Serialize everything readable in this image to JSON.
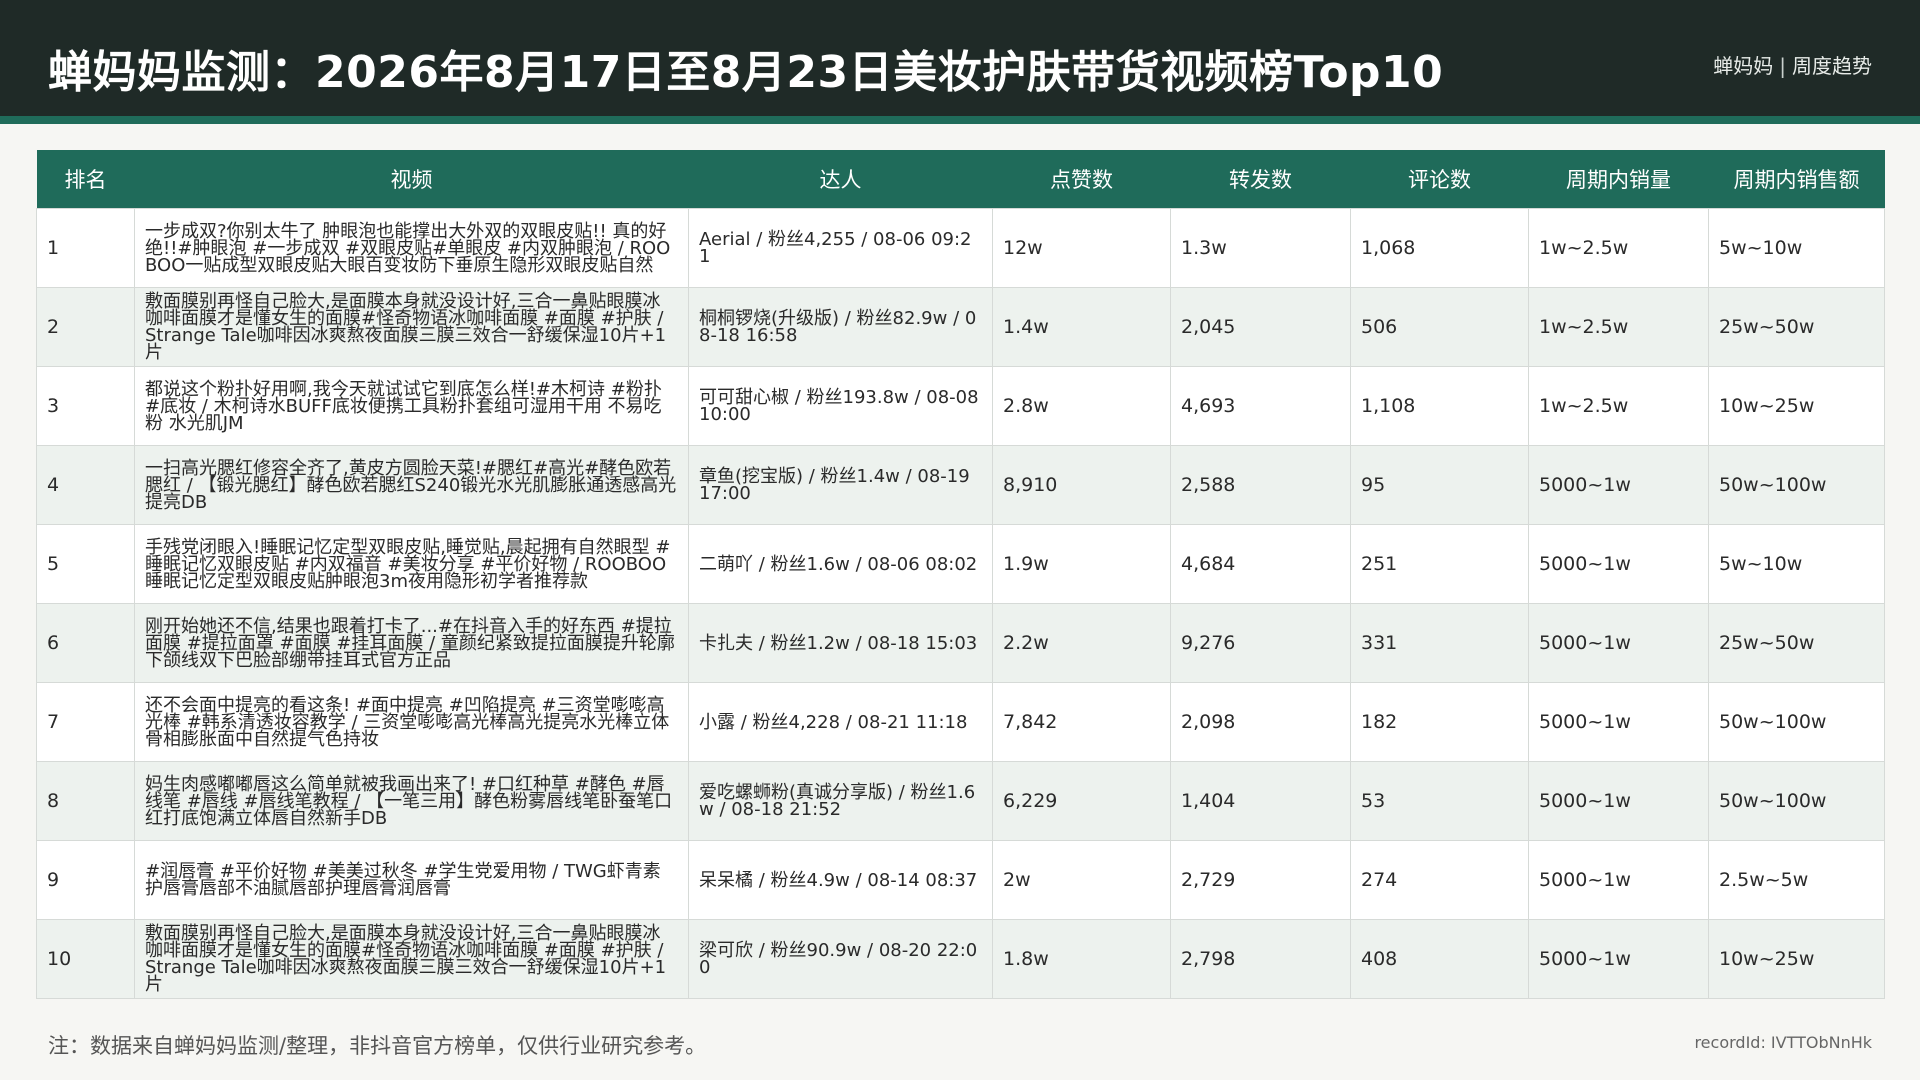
{
  "header": {
    "title": "蝉妈妈监测：2026年8月17日至8月23日美妆护肤带货视频榜Top10",
    "brand": "蝉妈妈",
    "brand_sep": "|",
    "brand_sub": "周度趋势"
  },
  "table": {
    "columns": [
      "排名",
      "视频",
      "达人",
      "点赞数",
      "转发数",
      "评论数",
      "周期内销量",
      "周期内销售额"
    ],
    "rows": [
      {
        "rank": "1",
        "video": "一步成双?你别太牛了 肿眼泡也能撑出大外双的双眼皮贴!! 真的好绝!!#肿眼泡 #一步成双 #双眼皮贴#单眼皮 #内双肿眼泡 / ROOBOO一贴成型双眼皮贴大眼百变妆防下垂原生隐形双眼皮贴自然",
        "talent": "Aerial / 粉丝4,255 / 08-06 09:21",
        "likes": "12w",
        "shares": "1.3w",
        "comments": "1,068",
        "sales": "1w~2.5w",
        "revenue": "5w~10w"
      },
      {
        "rank": "2",
        "video": "敷面膜别再怪自己脸大,是面膜本身就没设计好,三合一鼻贴眼膜冰咖啡面膜才是懂女生的面膜#怪奇物语冰咖啡面膜 #面膜 #护肤 / Strange Tale咖啡因冰爽熬夜面膜三膜三效合一舒缓保湿10片+1片",
        "talent": "桐桐锣烧(升级版) / 粉丝82.9w / 08-18 16:58",
        "likes": "1.4w",
        "shares": "2,045",
        "comments": "506",
        "sales": "1w~2.5w",
        "revenue": "25w~50w"
      },
      {
        "rank": "3",
        "video": "都说这个粉扑好用啊,我今天就试试它到底怎么样!#木柯诗 #粉扑 #底妆 / 木柯诗水BUFF底妆便携工具粉扑套组可湿用干用 不易吃粉 水光肌JM",
        "talent": "可可甜心椒 / 粉丝193.8w / 08-08 10:00",
        "likes": "2.8w",
        "shares": "4,693",
        "comments": "1,108",
        "sales": "1w~2.5w",
        "revenue": "10w~25w"
      },
      {
        "rank": "4",
        "video": "一扫高光腮红修容全齐了,黄皮方圆脸天菜!#腮红#高光#酵色欧若腮红 / 【锻光腮红】酵色欧若腮红S240锻光水光肌膨胀通透感高光提亮DB",
        "talent": "章鱼(挖宝版) / 粉丝1.4w / 08-19 17:00",
        "likes": "8,910",
        "shares": "2,588",
        "comments": "95",
        "sales": "5000~1w",
        "revenue": "50w~100w"
      },
      {
        "rank": "5",
        "video": "手残党闭眼入!睡眠记忆定型双眼皮贴,睡觉贴,晨起拥有自然眼型 #睡眠记忆双眼皮贴 #内双福音 #美妆分享 #平价好物 / ROOBOO睡眠记忆定型双眼皮贴肿眼泡3m夜用隐形初学者推荐款",
        "talent": "二萌吖 / 粉丝1.6w / 08-06 08:02",
        "likes": "1.9w",
        "shares": "4,684",
        "comments": "251",
        "sales": "5000~1w",
        "revenue": "5w~10w"
      },
      {
        "rank": "6",
        "video": "刚开始她还不信,结果也跟着打卡了...#在抖音入手的好东西 #提拉面膜 #提拉面罩 #面膜 #挂耳面膜 / 童颜纪紧致提拉面膜提升轮廓下颌线双下巴脸部绷带挂耳式官方正品",
        "talent": "卡扎夫 / 粉丝1.2w / 08-18 15:03",
        "likes": "2.2w",
        "shares": "9,276",
        "comments": "331",
        "sales": "5000~1w",
        "revenue": "25w~50w"
      },
      {
        "rank": "7",
        "video": "还不会面中提亮的看这条! #面中提亮 #凹陷提亮 #三资堂嘭嘭高光棒 #韩系清透妆容教学 / 三资堂嘭嘭高光棒高光提亮水光棒立体骨相膨胀面中自然提气色持妆",
        "talent": "小露 / 粉丝4,228 / 08-21 11:18",
        "likes": "7,842",
        "shares": "2,098",
        "comments": "182",
        "sales": "5000~1w",
        "revenue": "50w~100w"
      },
      {
        "rank": "8",
        "video": "妈生肉感嘟嘟唇这么简单就被我画出来了! #口红种草 #酵色 #唇线笔 #唇线 #唇线笔教程 / 【一笔三用】酵色粉雾唇线笔卧蚕笔口红打底饱满立体唇自然新手DB",
        "talent": "爱吃螺蛳粉(真诚分享版) / 粉丝1.6w / 08-18 21:52",
        "likes": "6,229",
        "shares": "1,404",
        "comments": "53",
        "sales": "5000~1w",
        "revenue": "50w~100w"
      },
      {
        "rank": "9",
        "video": "#润唇膏 #平价好物 #美美过秋冬 #学生党爱用物 / TWG虾青素护唇膏唇部不油腻唇部护理唇膏润唇膏",
        "talent": "呆呆橘 / 粉丝4.9w / 08-14 08:37",
        "likes": "2w",
        "shares": "2,729",
        "comments": "274",
        "sales": "5000~1w",
        "revenue": "2.5w~5w"
      },
      {
        "rank": "10",
        "video": "敷面膜别再怪自己脸大,是面膜本身就没设计好,三合一鼻贴眼膜冰咖啡面膜才是懂女生的面膜#怪奇物语冰咖啡面膜 #面膜 #护肤 / Strange Tale咖啡因冰爽熬夜面膜三膜三效合一舒缓保湿10片+1片",
        "talent": "梁可欣 / 粉丝90.9w / 08-20 22:00",
        "likes": "1.8w",
        "shares": "2,798",
        "comments": "408",
        "sales": "5000~1w",
        "revenue": "10w~25w"
      }
    ]
  },
  "footer": {
    "note": "注：数据来自蝉妈妈监测/整理，非抖音官方榜单，仅供行业研究参考。",
    "record_id": "recordId: IVTTObNnHk"
  },
  "colors": {
    "header_bg": "#1f2a27",
    "accent": "#1f6b5a",
    "row_alt": "#edf2ee"
  }
}
